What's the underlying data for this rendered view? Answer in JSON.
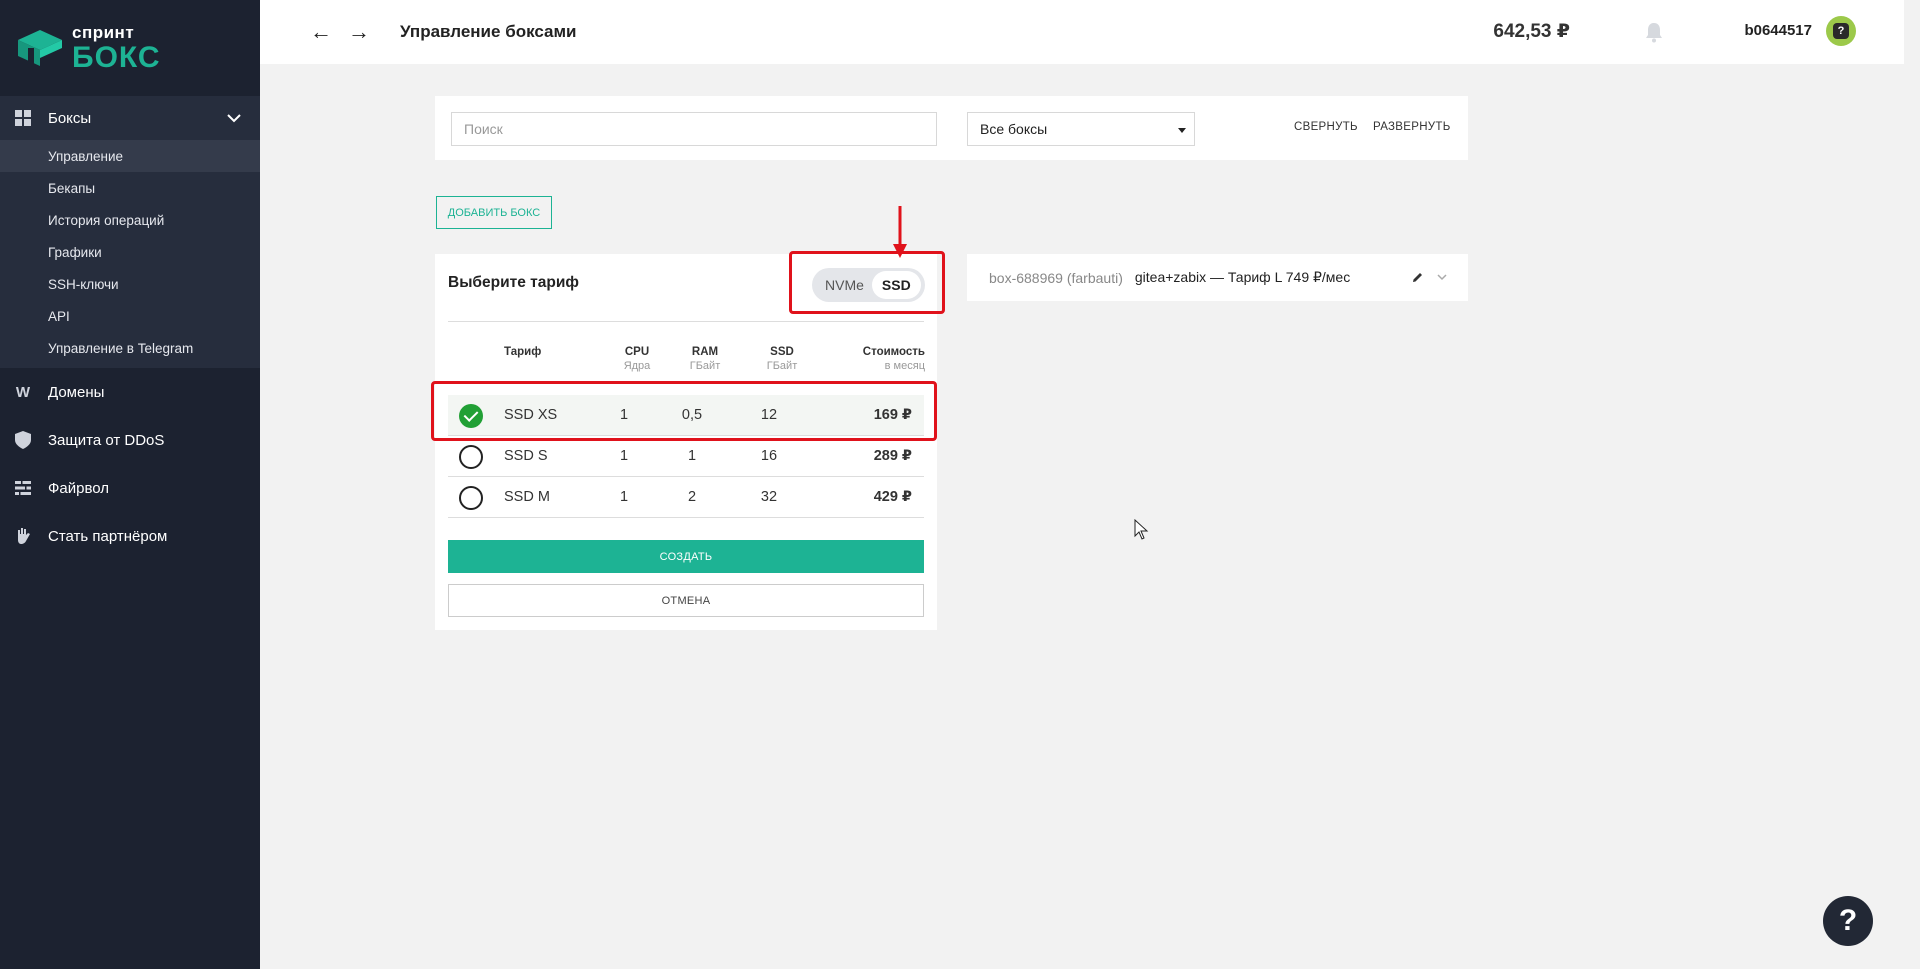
{
  "logo": {
    "top": "спринт",
    "bottom": "БОКС"
  },
  "sidebar": {
    "boxes": {
      "label": "Боксы",
      "items": [
        {
          "label": "Управление",
          "active": true
        },
        {
          "label": "Бекапы"
        },
        {
          "label": "История операций"
        },
        {
          "label": "Графики"
        },
        {
          "label": "SSH-ключи"
        },
        {
          "label": "API"
        },
        {
          "label": "Управление в Telegram"
        }
      ]
    },
    "items": [
      {
        "label": "Домены",
        "icon": "w-icon"
      },
      {
        "label": "Защита от DDoS",
        "icon": "shield-icon"
      },
      {
        "label": "Файрвол",
        "icon": "firewall-icon"
      },
      {
        "label": "Стать партнёром",
        "icon": "partner-hand-icon"
      }
    ],
    "domains_icon_glyph": "W"
  },
  "header": {
    "back_glyph": "←",
    "forward_glyph": "→",
    "title": "Управление боксами",
    "balance": "642,53 ₽",
    "username": "b0644517",
    "avatar_glyph": "?"
  },
  "filter": {
    "search_placeholder": "Поиск",
    "select_value": "Все боксы",
    "collapse_label": "СВЕРНУТЬ",
    "expand_label": "РАЗВЕРНУТЬ"
  },
  "add_box_label": "ДОБАВИТЬ БОКС",
  "tariff": {
    "title": "Выберите тариф",
    "toggle": {
      "nvme": "NVMe",
      "ssd": "SSD",
      "selected": "SSD"
    },
    "columns": {
      "tariff": "Тариф",
      "cpu": "CPU",
      "cpu_sub": "Ядра",
      "ram": "RAM",
      "ram_sub": "ГБайт",
      "ssd": "SSD",
      "ssd_sub": "ГБайт",
      "price": "Стоимость",
      "price_sub": "в месяц"
    },
    "rows": [
      {
        "name": "SSD XS",
        "cpu": "1",
        "ram": "0,5",
        "ssd": "12",
        "price": "169 ₽",
        "selected": true
      },
      {
        "name": "SSD S",
        "cpu": "1",
        "ram": "1",
        "ssd": "16",
        "price": "289 ₽",
        "selected": false
      },
      {
        "name": "SSD M",
        "cpu": "1",
        "ram": "2",
        "ssd": "32",
        "price": "429 ₽",
        "selected": false
      }
    ],
    "create_label": "СОЗДАТЬ",
    "cancel_label": "ОТМЕНА"
  },
  "box_card": {
    "id": "box-688969 (farbauti)",
    "name": "gitea+zabix — Тариф L 749 ₽/мес"
  },
  "help_glyph": "?",
  "colors": {
    "accent": "#1db394",
    "sidebar": "#1c2230",
    "highlight": "#e0121b",
    "check": "#21a035"
  }
}
